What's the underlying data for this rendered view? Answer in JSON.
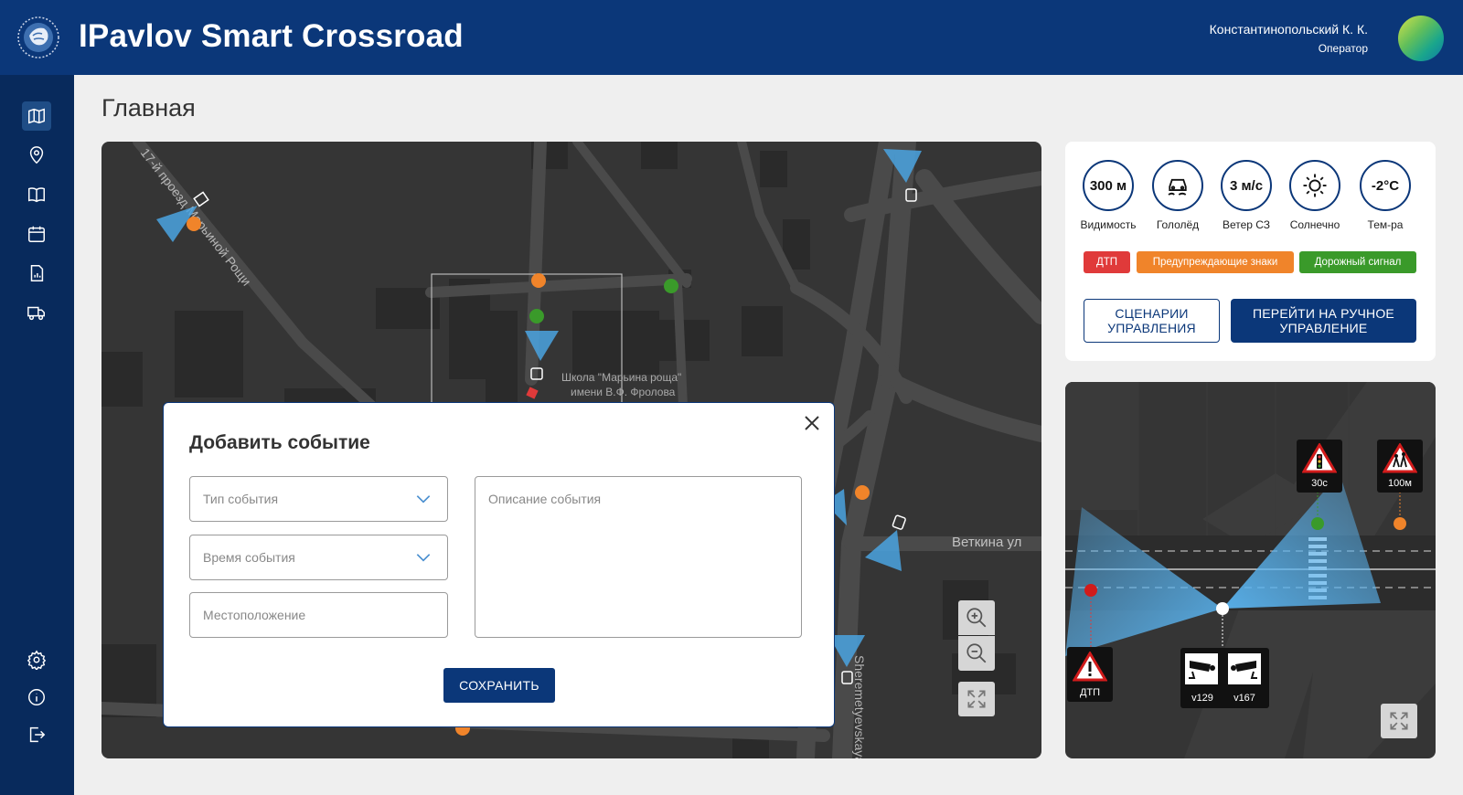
{
  "header": {
    "title": "IPavlov Smart Crossroad",
    "user_name": "Константинопольский К. К.",
    "user_role": "Оператор"
  },
  "sidebar": {
    "top_items": [
      "map-icon",
      "location-pin-icon",
      "book-icon",
      "calendar-icon",
      "report-icon",
      "truck-icon"
    ],
    "bottom_items": [
      "settings-icon",
      "info-icon",
      "logout-icon"
    ],
    "active": "map-icon"
  },
  "page": {
    "title": "Главная"
  },
  "map": {
    "labels": {
      "street_1": "17-й проезд Марьиной Рощи",
      "school": "Школа \"Марьина роща\"",
      "school_2": "имени В.Ф. Фролова",
      "street_2": "Веткина ул",
      "street_3": "Sheremetyevskaya"
    },
    "controls": [
      "zoom-in-icon",
      "zoom-out-icon",
      "fullscreen-icon"
    ]
  },
  "modal": {
    "title": "Добавить событие",
    "event_type_placeholder": "Тип события",
    "event_time_placeholder": "Время события",
    "location_placeholder": "Местоположение",
    "description_placeholder": "Описание события",
    "save_label": "СОХРАНИТЬ"
  },
  "weather": {
    "items": [
      {
        "value": "300 м",
        "label": "Видимость"
      },
      {
        "value": "",
        "label": "Гололёд",
        "icon": "icy-road-icon"
      },
      {
        "value": "3 м/с",
        "label": "Ветер СЗ"
      },
      {
        "value": "",
        "label": "Солнечно",
        "icon": "sun-icon"
      },
      {
        "value": "-2°С",
        "label": "Тем-ра"
      }
    ],
    "tags": [
      {
        "label": "ДТП",
        "color": "#e03a3a"
      },
      {
        "label": "Предупреждающие знаки",
        "color": "#f0842a"
      },
      {
        "label": "Дорожный сигнал",
        "color": "#3a9a2a"
      }
    ],
    "scenarios_button": "СЦЕНАРИИ УПРАВЛЕНИЯ",
    "manual_button": "ПЕРЕЙТИ НА РУЧНОЕ УПРАВЛЕНИЕ"
  },
  "crossroad": {
    "signs": {
      "traffic_light": "30с",
      "children": "100м",
      "accident": "ДТП",
      "camera_1": "v129",
      "camera_2": "v167"
    }
  },
  "colors": {
    "brand": "#0b3779",
    "red": "#e03a3a",
    "orange": "#f0842a",
    "green": "#3a9a2a"
  }
}
